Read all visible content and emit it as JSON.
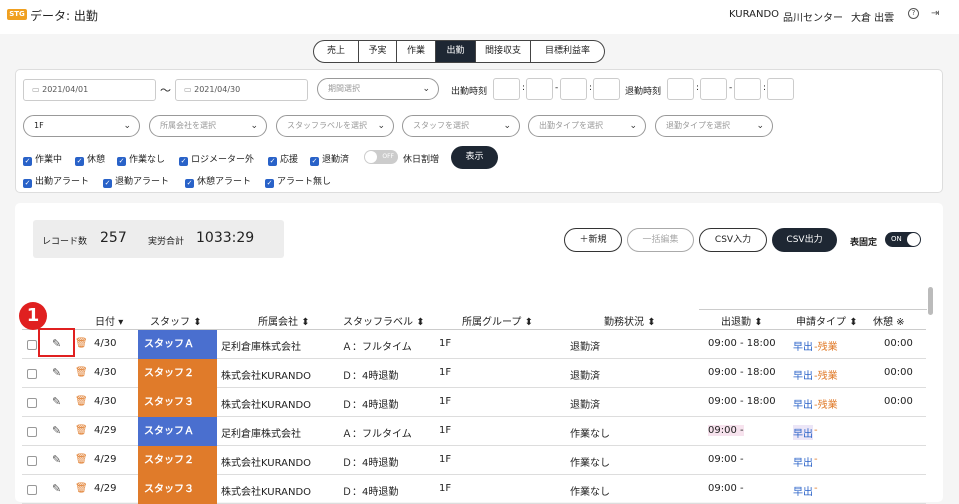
{
  "header": {
    "logo": "STG",
    "title": "データ: 出勤",
    "company": "KURANDO",
    "site": "品川センター",
    "user": "大倉 出雲",
    "help_icon": "?",
    "logout_icon": "⇥"
  },
  "tabs": [
    "売上",
    "予実",
    "作業",
    "出勤",
    "間接収支",
    "目標利益率"
  ],
  "filters": {
    "date_from": "2021/04/01",
    "tilde": "〜",
    "date_to": "2021/04/30",
    "period_placeholder": "期間選択",
    "clock_in_label": "出勤時刻",
    "clock_out_label": "退勤時刻",
    "colon": ":",
    "dash": "-",
    "floor": "1F",
    "company_placeholder": "所属会社を選択",
    "staff_label_placeholder": "スタッフラベルを選択",
    "staff_placeholder": "スタッフを選択",
    "in_type_placeholder": "出勤タイプを選択",
    "out_type_placeholder": "退勤タイプを選択",
    "checks1": [
      "作業中",
      "休憩",
      "作業なし",
      "ロジメーター外",
      "応援",
      "退勤済"
    ],
    "toggle_text": "OFF",
    "holiday_label": "休日割増",
    "show_button": "表示",
    "checks2": [
      "出勤アラート",
      "退勤アラート",
      "休憩アラート",
      "アラート無し"
    ]
  },
  "summary": {
    "record_label": "レコード数",
    "record_count": "257",
    "total_label": "実労合計",
    "total_value": "1033:29"
  },
  "actions": {
    "new": "＋新規",
    "bulk_edit": "一括編集",
    "csv_in": "CSV入力",
    "csv_out": "CSV出力",
    "fix_label": "表固定",
    "fix_toggle": "ON"
  },
  "callout": "1",
  "table": {
    "headers": {
      "date": "日付",
      "staff": "スタッフ",
      "company": "所属会社",
      "label": "スタッフラベル",
      "group": "所属グループ",
      "status": "勤務状況",
      "inout": "出退勤",
      "type": "申請タイプ",
      "rest": "休憩 ※"
    },
    "sort_down": "▾",
    "sort_both": "⬍",
    "rows": [
      {
        "date": "4/30",
        "staff": "スタッフＡ",
        "staff_color": "#4a6fcf",
        "company": "足利倉庫株式会社",
        "label": "Ａ：フルタイム",
        "group": "1F",
        "status": "退勤済",
        "inout": "09:00 - 18:00",
        "type_a": "早出",
        "type_b": "-残業",
        "rest": "00:00"
      },
      {
        "date": "4/30",
        "staff": "スタッフ２",
        "staff_color": "#e07b2a",
        "company": "株式会社KURANDO",
        "label": "Ｄ：4時退勤",
        "group": "1F",
        "status": "退勤済",
        "inout": "09:00 - 18:00",
        "type_a": "早出",
        "type_b": "-残業",
        "rest": "00:00"
      },
      {
        "date": "4/30",
        "staff": "スタッフ３",
        "staff_color": "#e07b2a",
        "company": "株式会社KURANDO",
        "label": "Ｄ：4時退勤",
        "group": "1F",
        "status": "退勤済",
        "inout": "09:00 - 18:00",
        "type_a": "早出",
        "type_b": "-残業",
        "rest": "00:00"
      },
      {
        "date": "4/29",
        "staff": "スタッフＡ",
        "staff_color": "#4a6fcf",
        "company": "足利倉庫株式会社",
        "label": "Ａ：フルタイム",
        "group": "1F",
        "status": "作業なし",
        "inout": "09:00 -",
        "type_a": "早出",
        "type_b": "-",
        "rest": ""
      },
      {
        "date": "4/29",
        "staff": "スタッフ２",
        "staff_color": "#e07b2a",
        "company": "株式会社KURANDO",
        "label": "Ｄ：4時退勤",
        "group": "1F",
        "status": "作業なし",
        "inout": "09:00 -",
        "type_a": "早出",
        "type_b": "-",
        "rest": ""
      },
      {
        "date": "4/29",
        "staff": "スタッフ３",
        "staff_color": "#e07b2a",
        "company": "株式会社KURANDO",
        "label": "Ｄ：4時退勤",
        "group": "1F",
        "status": "作業なし",
        "inout": "09:00 -",
        "type_a": "早出",
        "type_b": "-",
        "rest": ""
      }
    ]
  }
}
